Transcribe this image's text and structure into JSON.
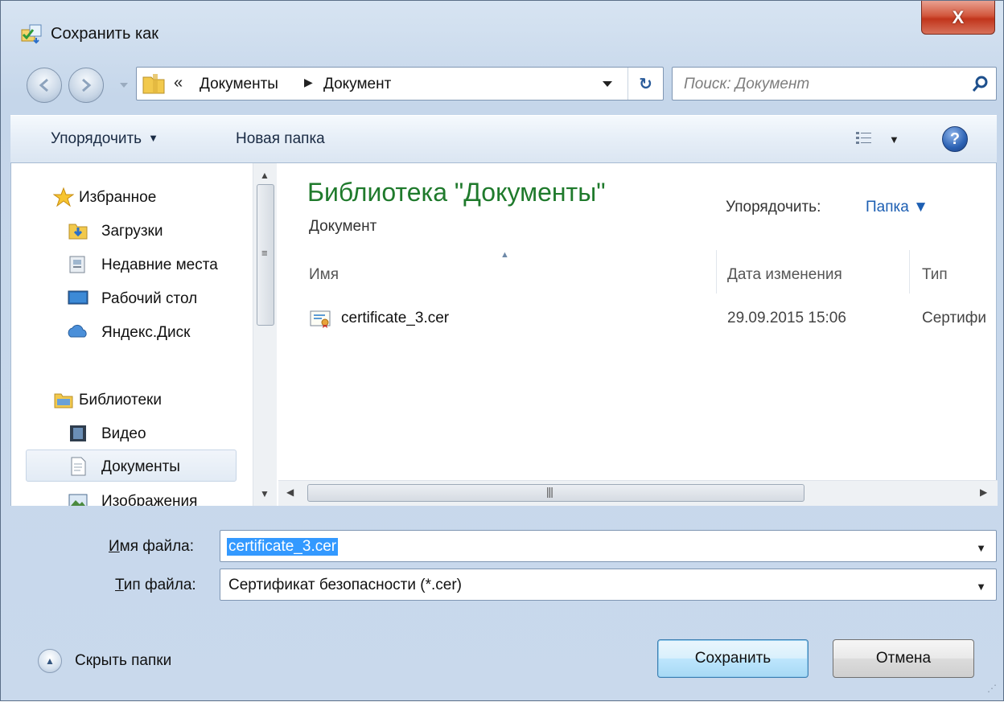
{
  "window": {
    "title": "Сохранить как",
    "close_label": "X"
  },
  "address": {
    "crumb_overflow": "«",
    "crumbs": [
      "Документы",
      "Документ"
    ],
    "separator": "▶",
    "refresh_glyph": "↻"
  },
  "search": {
    "placeholder": "Поиск: Документ"
  },
  "toolbar": {
    "organize_label": "Упорядочить",
    "new_folder_label": "Новая папка",
    "help_glyph": "?"
  },
  "sidebar": {
    "items": [
      {
        "label": "Избранное",
        "icon": "star-icon"
      },
      {
        "label": "Загрузки",
        "icon": "downloads-folder-icon"
      },
      {
        "label": "Недавние места",
        "icon": "recent-places-icon"
      },
      {
        "label": "Рабочий стол",
        "icon": "desktop-icon"
      },
      {
        "label": "Яндекс.Диск",
        "icon": "cloud-icon"
      },
      {
        "label": "Библиотеки",
        "icon": "libraries-icon"
      },
      {
        "label": "Видео",
        "icon": "video-icon"
      },
      {
        "label": "Документы",
        "icon": "documents-icon",
        "selected": true
      },
      {
        "label": "Изображения",
        "icon": "pictures-icon"
      }
    ]
  },
  "library": {
    "title": "Библиотека \"Документы\"",
    "subtitle": "Документ",
    "arrange_label": "Упорядочить:",
    "arrange_value": "Папка ▼"
  },
  "columns": {
    "name": "Имя",
    "date": "Дата изменения",
    "type": "Тип"
  },
  "files": [
    {
      "name": "certificate_3.cer",
      "date": "29.09.2015 15:06",
      "type": "Сертифи",
      "icon": "certificate-icon"
    }
  ],
  "form": {
    "filename_label_u": "И",
    "filename_label_rest": "мя файла:",
    "filename_value": "certificate_3.cer",
    "filetype_label_u": "Т",
    "filetype_label_rest": "ип файла:",
    "filetype_value": "Сертификат безопасности (*.cer)"
  },
  "footer": {
    "hide_folders_label": "Скрыть папки",
    "save_label": "Сохранить",
    "cancel_label": "Отмена"
  },
  "colors": {
    "library_title": "#1f7a2c",
    "link": "#1d5fb3",
    "selection": "#3399ff",
    "close_button": "#c1351b"
  }
}
